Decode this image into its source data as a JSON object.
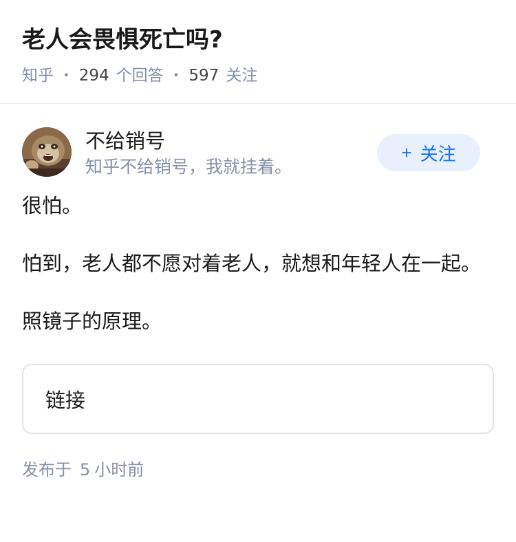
{
  "question": {
    "title": "老人会畏惧死亡吗?",
    "source": "知乎",
    "answer_count": "294",
    "answer_label": "个回答",
    "follower_count": "597",
    "follower_label": "关注"
  },
  "author": {
    "name": "不给销号",
    "bio": "知乎不给销号，我就挂着。",
    "avatar_icon": "sloth-avatar",
    "follow_label": "关注",
    "follow_icon": "plus-icon",
    "accent_color": "#1772f6"
  },
  "answer": {
    "paragraphs": [
      "很怕。",
      "怕到，老人都不愿对着老人，就想和年轻人在一起。",
      "照镜子的原理。"
    ],
    "link_label": "链接",
    "published_prefix": "发布于",
    "published_num": "5",
    "published_suffix": "小时前"
  }
}
